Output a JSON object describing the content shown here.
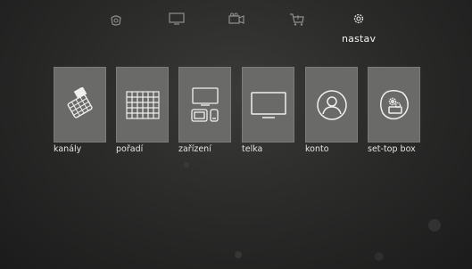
{
  "topnav": {
    "items": [
      {
        "icon": "tv-logo-icon"
      },
      {
        "icon": "television-icon"
      },
      {
        "icon": "video-camera-icon"
      },
      {
        "icon": "shopping-cart-icon"
      },
      {
        "icon": "gear-icon",
        "label": "nastav",
        "active": true
      }
    ]
  },
  "tiles": [
    {
      "label": "kanály",
      "icon": "remote-control-icon"
    },
    {
      "label": "pořadí",
      "icon": "grid-icon"
    },
    {
      "label": "zařízení",
      "icon": "devices-icon"
    },
    {
      "label": "telka",
      "icon": "monitor-icon"
    },
    {
      "label": "konto",
      "icon": "user-icon"
    },
    {
      "label": "set-top box",
      "icon": "settings-box-icon"
    }
  ]
}
